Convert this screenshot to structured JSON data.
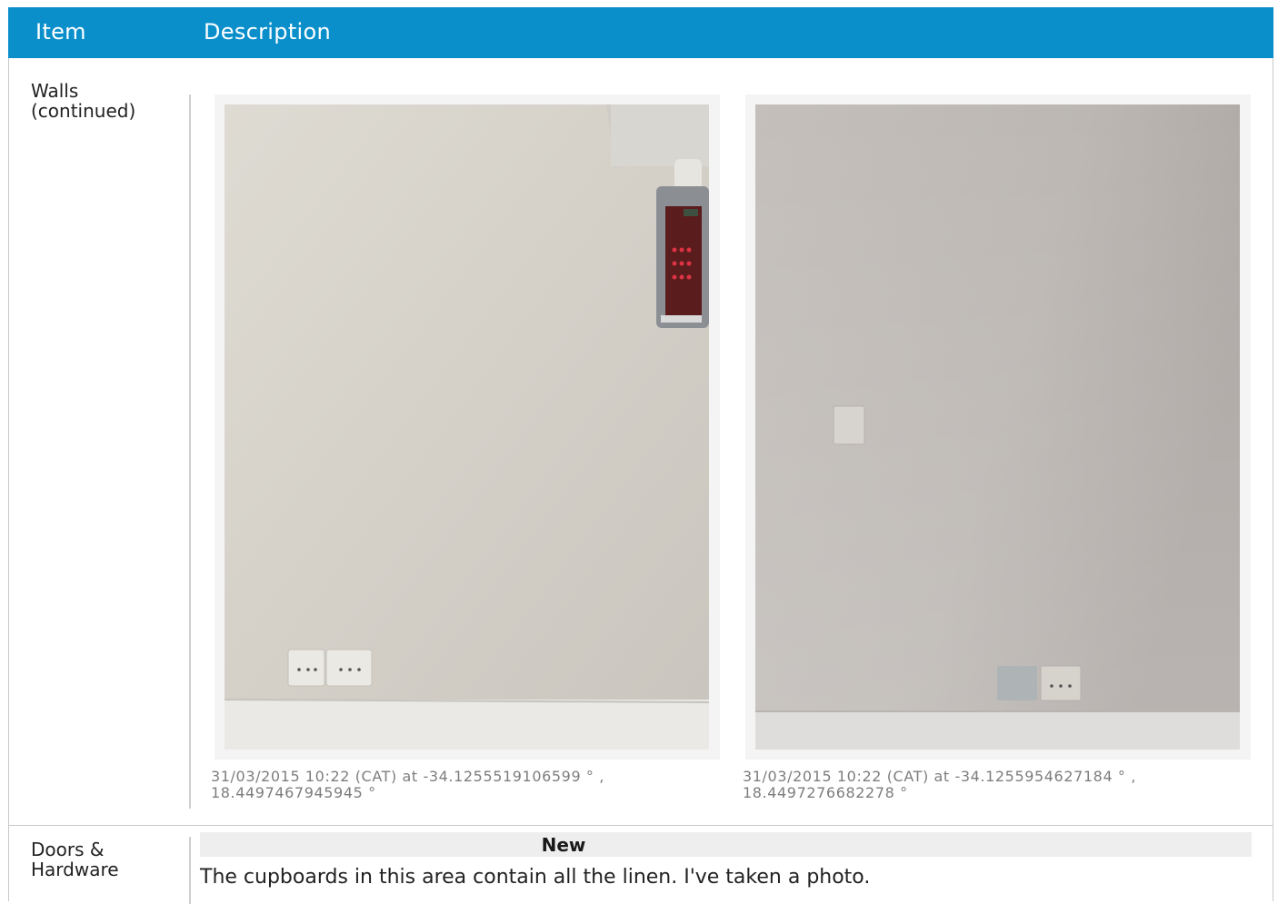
{
  "header": {
    "item_label": "Item",
    "description_label": "Description"
  },
  "rows": [
    {
      "item": "Walls (continued)",
      "photos": [
        {
          "caption": "31/03/2015 10:22 (CAT) at -34.1255519106599 ° , 18.4497467945945 °"
        },
        {
          "caption": "31/03/2015 10:22 (CAT) at -34.1255954627184 ° , 18.4497276682278 °"
        }
      ]
    },
    {
      "item": "Doors & Hardware",
      "status": "New",
      "note": "The cupboards in this area contain all the linen. I've taken a photo."
    }
  ],
  "colors": {
    "header_bg": "#0a8fcb",
    "header_text": "#ffffff",
    "caption_text": "#7d7d7d",
    "status_bar_bg": "#eeeeee"
  }
}
